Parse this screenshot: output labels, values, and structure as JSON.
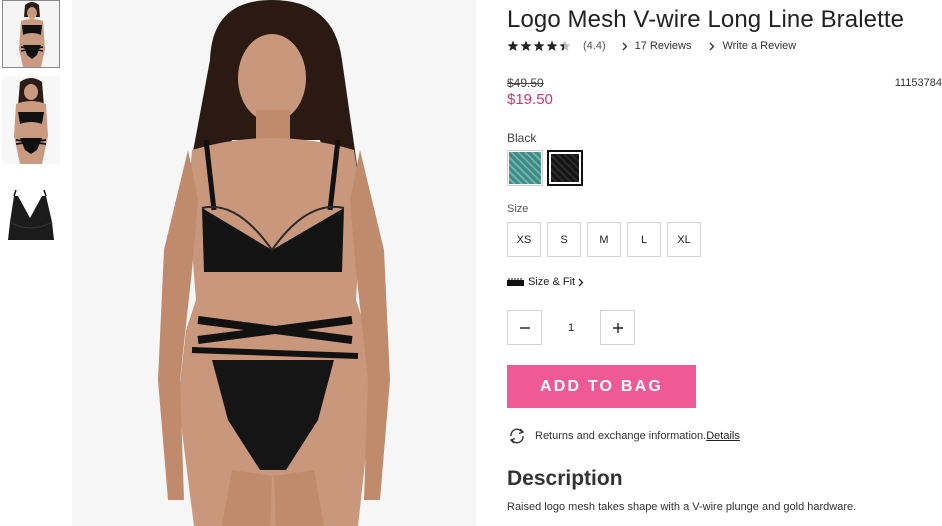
{
  "product": {
    "title": "Logo Mesh V-wire Long Line Bralette",
    "rating": 4.4,
    "rating_text": "(4.4)",
    "reviews_link": "17 Reviews",
    "write_review_link": "Write a Review",
    "price_original": "$49.50",
    "price_sale": "$19.50",
    "sku": "11153784"
  },
  "color": {
    "label": "Black",
    "swatches": [
      {
        "name": "teal-print",
        "color": "#3f8a85",
        "selected": false
      },
      {
        "name": "black",
        "color": "#151515",
        "selected": true
      }
    ]
  },
  "size": {
    "label": "Size",
    "options": [
      "XS",
      "S",
      "M",
      "L",
      "XL"
    ]
  },
  "fit_link": "Size & Fit",
  "quantity": {
    "value": "1"
  },
  "add_to_bag": "ADD TO BAG",
  "returns": {
    "text": "Returns and exchange information.",
    "link": "Details"
  },
  "description": {
    "title": "Description",
    "text": "Raised logo mesh takes shape with a V-wire plunge and gold hardware."
  },
  "colors": {
    "accent": "#ef5a96",
    "sale_price": "#d6336c"
  }
}
